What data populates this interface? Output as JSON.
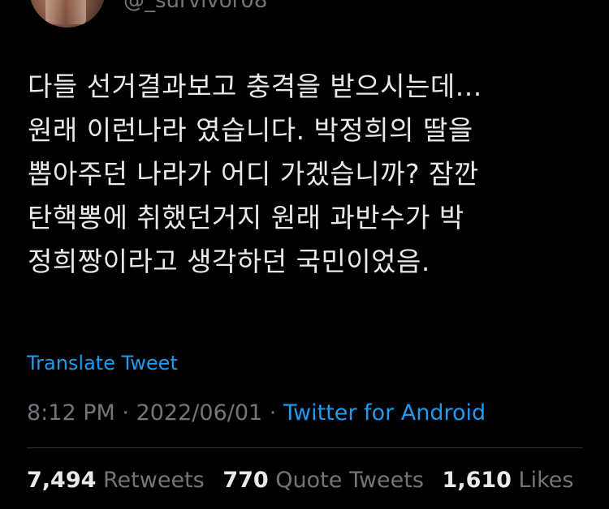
{
  "author": {
    "handle": "@_survivor08"
  },
  "tweet": {
    "lines": [
      "다들 선거결과보고 충격을 받으시는데...",
      "원래 이런나라 였습니다. 박정희의 딸을",
      "뽑아주던 나라가 어디 가겠습니까? 잠깐",
      "탄핵뽕에 취했던거지 원래 과반수가 박",
      "정희짱이라고 생각하던 국민이었음."
    ],
    "translate_label": "Translate Tweet",
    "time": "8:12 PM",
    "separator": "·",
    "date": "2022/06/01",
    "source": "Twitter for Android"
  },
  "stats": {
    "retweets_count": "7,494",
    "retweets_label": "Retweets",
    "quotes_count": "770",
    "quotes_label": "Quote Tweets",
    "likes_count": "1,610",
    "likes_label": "Likes"
  },
  "colors": {
    "background": "#000000",
    "text": "#e7e9ea",
    "muted": "#71767b",
    "link": "#1d9bf0",
    "divider": "#2f3336"
  }
}
